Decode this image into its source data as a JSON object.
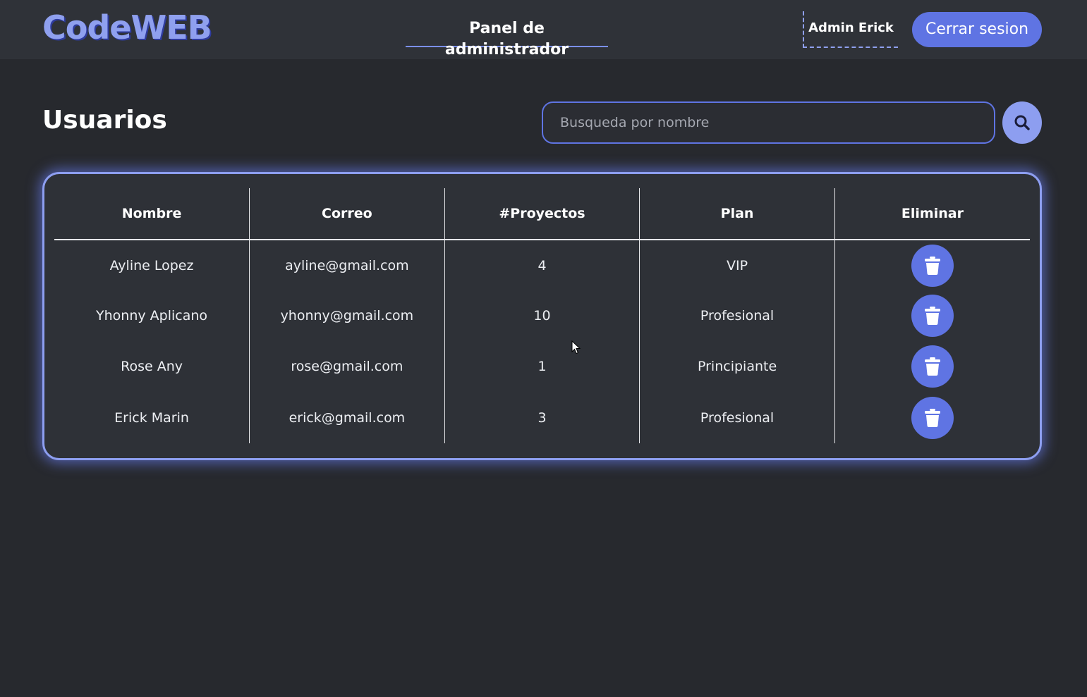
{
  "header": {
    "logo": "CodeWEB",
    "nav_title": "Panel de administrador",
    "admin_name": "Admin Erick",
    "logout_label": "Cerrar sesion"
  },
  "main": {
    "title": "Usuarios",
    "search_placeholder": "Busqueda por nombre",
    "search_icon": "search-icon"
  },
  "table": {
    "columns": [
      "Nombre",
      "Correo",
      "#Proyectos",
      "Plan",
      "Eliminar"
    ],
    "rows": [
      {
        "name": "Ayline Lopez",
        "email": "ayline@gmail.com",
        "projects": "4",
        "plan": "VIP"
      },
      {
        "name": "Yhonny Aplicano",
        "email": "yhonny@gmail.com",
        "projects": "10",
        "plan": "Profesional"
      },
      {
        "name": "Rose Any",
        "email": "rose@gmail.com",
        "projects": "1",
        "plan": "Principiante"
      },
      {
        "name": "Erick Marin",
        "email": "erick@gmail.com",
        "projects": "3",
        "plan": "Profesional"
      }
    ],
    "delete_icon": "trash-icon"
  },
  "colors": {
    "accent": "#5f74e3",
    "accent_light": "#8d9ef0",
    "background": "#27292e",
    "header_bg": "#2f3238",
    "card_bg": "#2e3137"
  }
}
